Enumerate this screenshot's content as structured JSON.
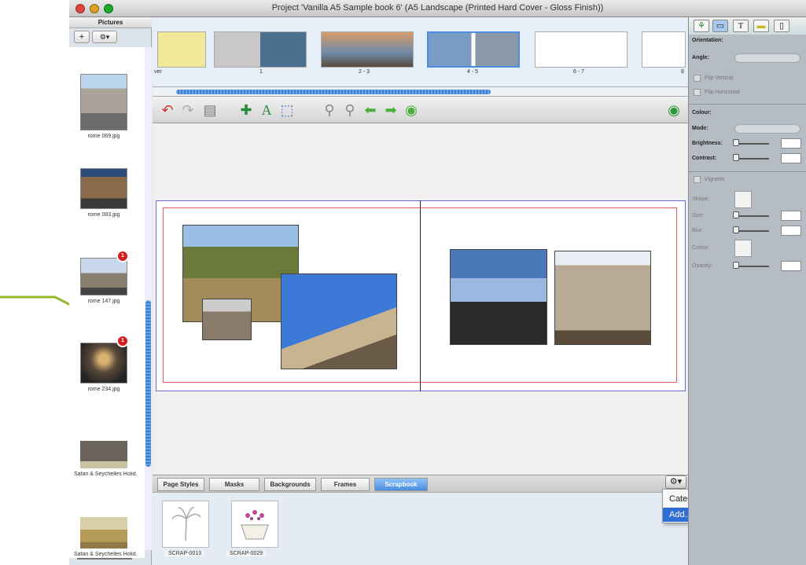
{
  "window": {
    "title": "Project 'Vanilla A5 Sample book 6' (A5 Landscape (Printed Hard Cover - Gloss Finish))"
  },
  "pictures_panel": {
    "title": "Pictures",
    "add_label": "+",
    "gear_label": "⚙▾",
    "items": [
      {
        "caption": "rome 069.jpg"
      },
      {
        "caption": "rome 083.jpg"
      },
      {
        "caption": "rome 147.jpg",
        "badge": "1"
      },
      {
        "caption": "rome 234.jpg",
        "badge": "1"
      },
      {
        "caption": "Safari & Seychelles Holid..."
      },
      {
        "caption": "Safari & Seychelles Holid..."
      }
    ]
  },
  "page_strip": {
    "cover_label": "ver",
    "pages": [
      {
        "label": "1"
      },
      {
        "label": "2 - 3"
      },
      {
        "label": "4 - 5"
      },
      {
        "label": "6 - 7"
      },
      {
        "label": "8"
      }
    ]
  },
  "toolbar": {
    "icons": [
      "undo-icon",
      "redo-icon",
      "trash-icon",
      "add-picture-icon",
      "add-text-icon",
      "add-shape-icon",
      "zoom-out-icon",
      "zoom-in-icon",
      "previous-page-icon",
      "next-page-icon",
      "play-icon",
      "cart-icon"
    ]
  },
  "tabs": [
    {
      "label": "Page Styles"
    },
    {
      "label": "Masks"
    },
    {
      "label": "Backgrounds"
    },
    {
      "label": "Frames"
    },
    {
      "label": "Scrapbook",
      "active": true
    }
  ],
  "scrapbook": [
    {
      "caption": "SCRAP-0013"
    },
    {
      "caption": "SCRAP-0029"
    }
  ],
  "context_menu": {
    "items": [
      {
        "label": "Category",
        "submenu": "▶"
      },
      {
        "label": "Add...",
        "selected": true
      }
    ]
  },
  "inspector": {
    "orientation": "Orientation:",
    "angle": "Angle:",
    "flip_vertical": "Flip Vertical",
    "flip_horizontal": "Flip Horizontal",
    "colour": "Colour:",
    "mode": "Mode:",
    "brightness": "Brightness:",
    "contrast": "Contrast:",
    "vignette": "Vignette",
    "shape": "Shape:",
    "size": "Size:",
    "blur": "Blur:",
    "vignette_colour": "Colour:",
    "opacity": "Opacity:"
  },
  "colors": {
    "accent": "#2f6fd5",
    "callout": "#93b72d",
    "badge": "#d31f1f"
  }
}
